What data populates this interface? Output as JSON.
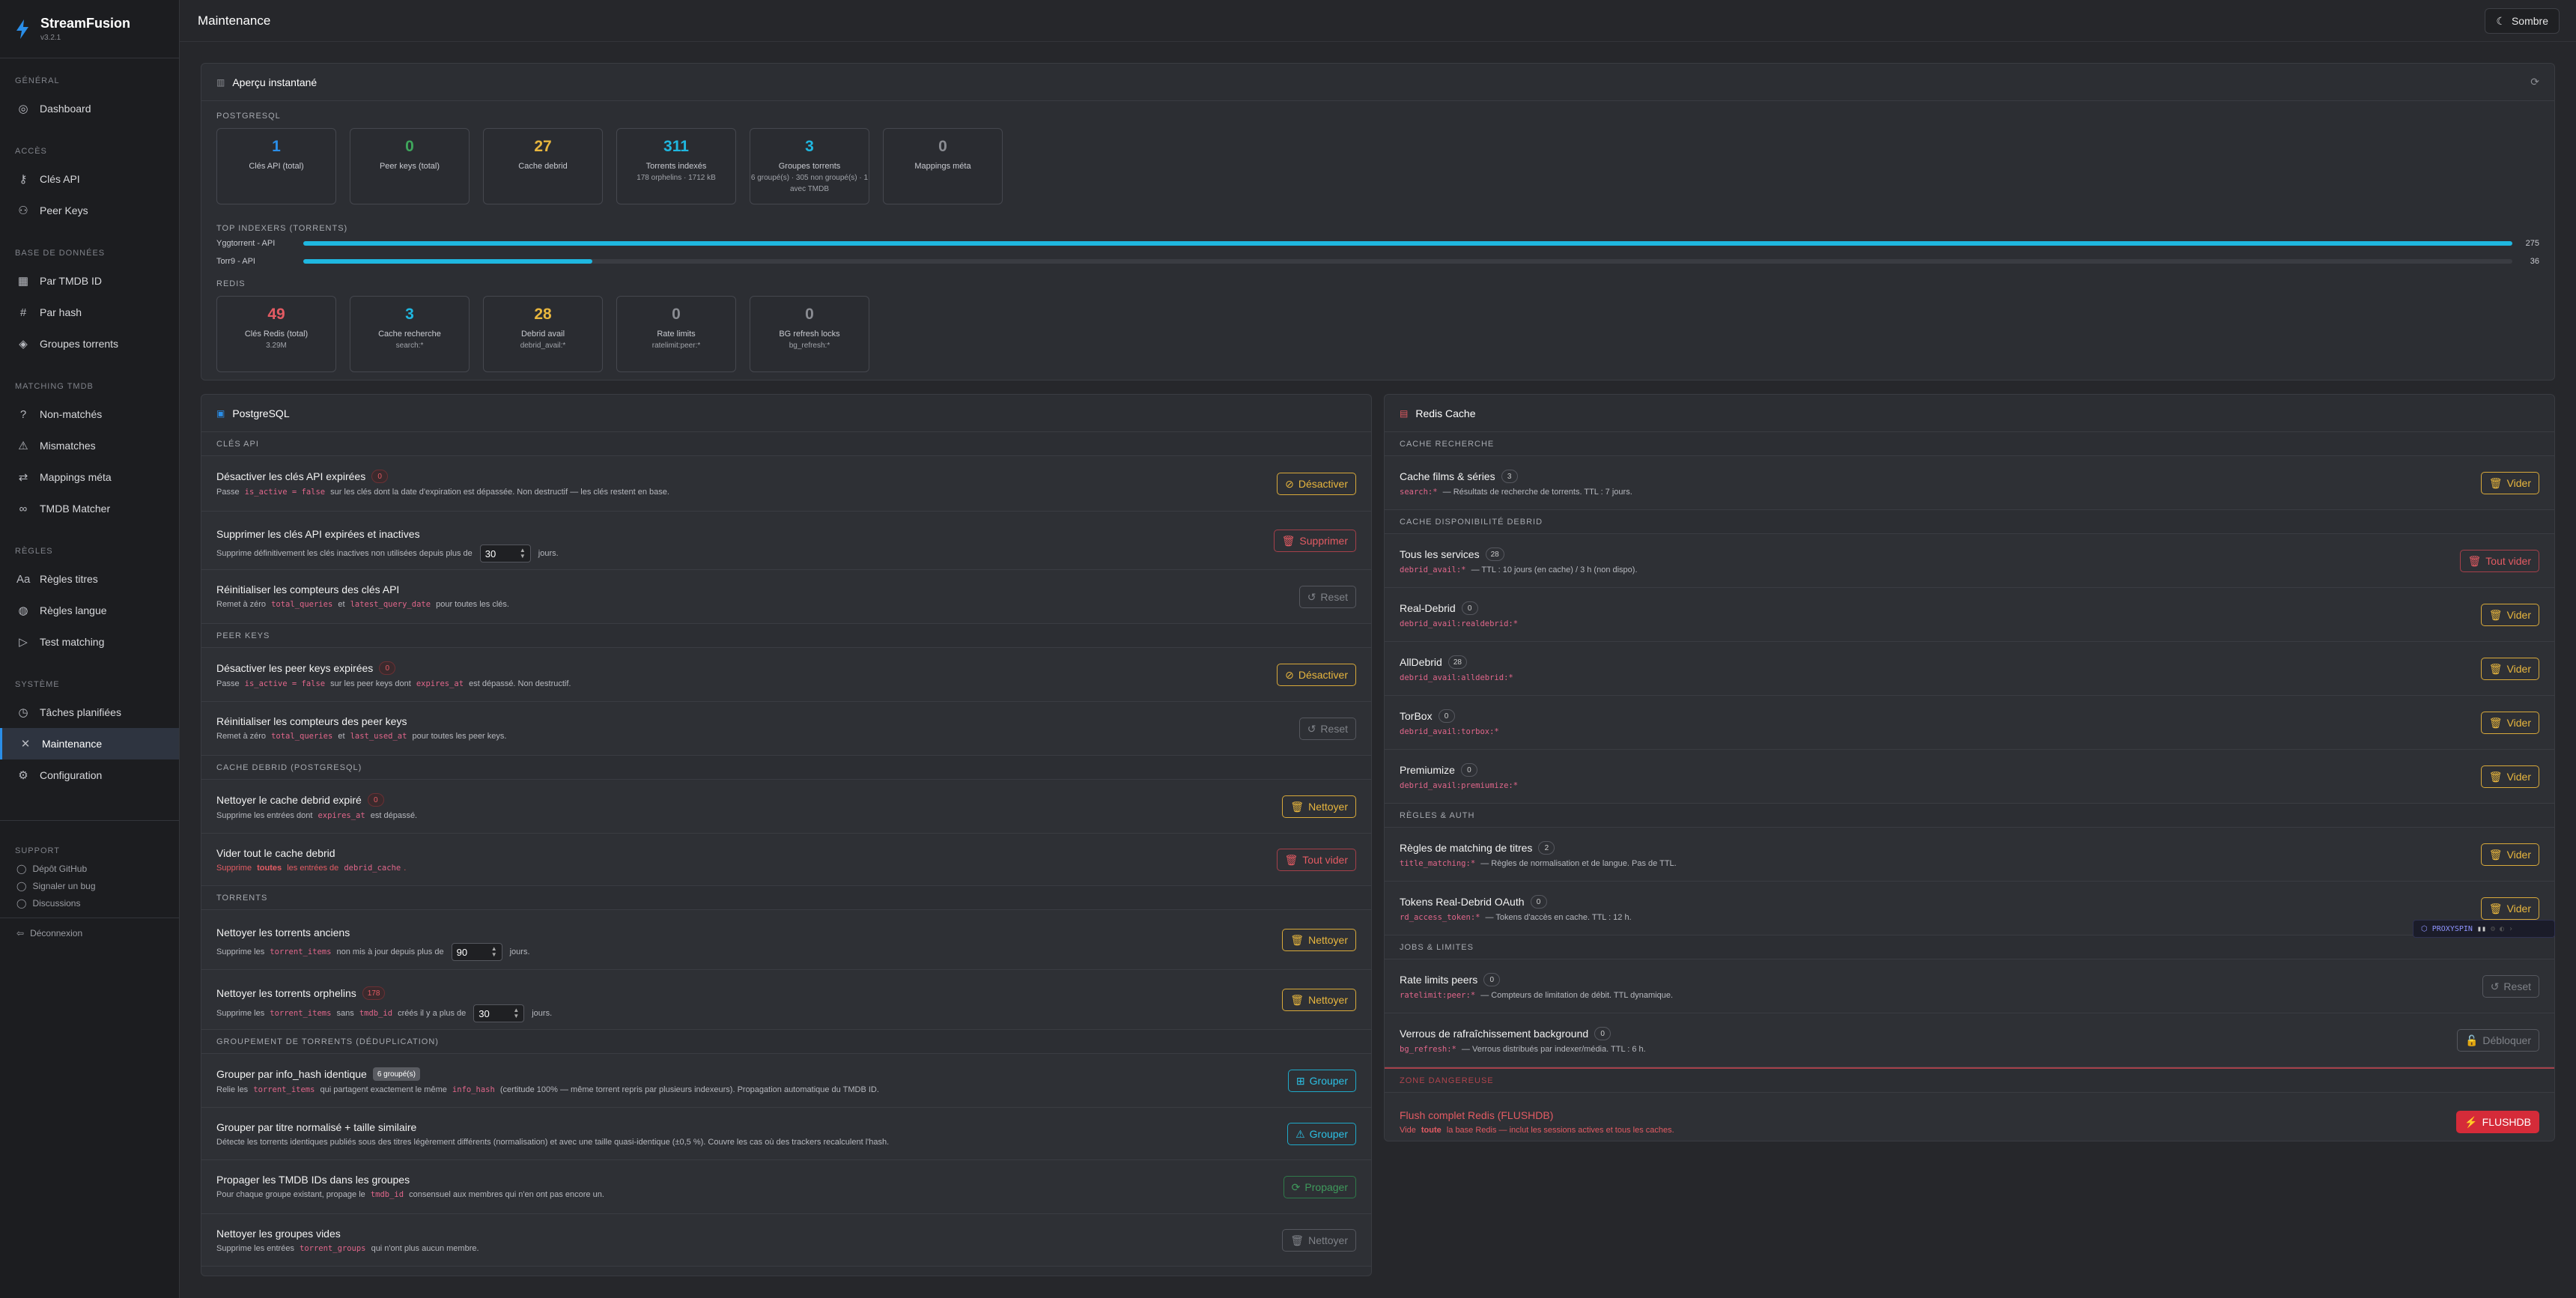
{
  "app": {
    "name": "StreamFusion",
    "version": "v3.2.1"
  },
  "sidebar": {
    "sections": [
      {
        "title": "Général",
        "items": [
          {
            "label": "Dashboard",
            "icon": "dashboard-icon"
          }
        ]
      },
      {
        "title": "Accès",
        "items": [
          {
            "label": "Clés API",
            "icon": "key-icon"
          },
          {
            "label": "Peer Keys",
            "icon": "users-icon"
          }
        ]
      },
      {
        "title": "Base de données",
        "items": [
          {
            "label": "Par TMDB ID",
            "icon": "film-icon"
          },
          {
            "label": "Par hash",
            "icon": "hash-icon"
          },
          {
            "label": "Groupes torrents",
            "icon": "layers-icon"
          }
        ]
      },
      {
        "title": "Matching TMDB",
        "items": [
          {
            "label": "Non-matchés",
            "icon": "help-circle-icon"
          },
          {
            "label": "Mismatches",
            "icon": "alert-icon"
          },
          {
            "label": "Mappings méta",
            "icon": "shuffle-icon"
          },
          {
            "label": "TMDB Matcher",
            "icon": "link-icon"
          }
        ]
      },
      {
        "title": "Règles",
        "items": [
          {
            "label": "Règles titres",
            "icon": "text-icon"
          },
          {
            "label": "Règles langue",
            "icon": "globe-icon"
          },
          {
            "label": "Test matching",
            "icon": "play-icon"
          }
        ]
      },
      {
        "title": "Système",
        "items": [
          {
            "label": "Tâches planifiées",
            "icon": "clock-icon"
          },
          {
            "label": "Maintenance",
            "icon": "tools-icon",
            "active": true
          },
          {
            "label": "Configuration",
            "icon": "gear-icon"
          }
        ]
      }
    ],
    "support": {
      "title": "Support",
      "links": [
        "Dépôt GitHub",
        "Signaler un bug",
        "Discussions"
      ]
    },
    "logout": "Déconnexion"
  },
  "header": {
    "title": "Maintenance",
    "theme_label": "Sombre"
  },
  "overview": {
    "title": "Aperçu instantané",
    "postgres_label": "PostgreSQL",
    "postgres_stats": [
      {
        "value": "1",
        "label": "Clés API (total)",
        "sub": "",
        "color": "#2a8ee8"
      },
      {
        "value": "0",
        "label": "Peer keys (total)",
        "sub": "",
        "color": "#3fa65c"
      },
      {
        "value": "27",
        "label": "Cache debrid",
        "sub": "",
        "color": "#e8b63e"
      },
      {
        "value": "311",
        "label": "Torrents indexés",
        "sub": "178 orphelins · 1712 kB",
        "color": "#1fb7e0"
      },
      {
        "value": "3",
        "label": "Groupes torrents",
        "sub": "6 groupé(s) · 305 non groupé(s) · 1 avec TMDB",
        "color": "#1fb7e0"
      },
      {
        "value": "0",
        "label": "Mappings méta",
        "sub": "",
        "color": "#8a8c92"
      }
    ],
    "indexers_label": "Top indexers (torrents)",
    "indexers": [
      {
        "name": "Yggtorrent - API",
        "value": 275,
        "max": 275
      },
      {
        "name": "Torr9 - API",
        "value": 36,
        "max": 275
      }
    ],
    "redis_label": "Redis",
    "redis_stats": [
      {
        "value": "49",
        "label": "Clés Redis (total)",
        "sub": "3.29M",
        "color": "#e35b63"
      },
      {
        "value": "3",
        "label": "Cache recherche",
        "sub": "search:*",
        "color": "#1fb7e0"
      },
      {
        "value": "28",
        "label": "Debrid avail",
        "sub": "debrid_avail:*",
        "color": "#e8b63e"
      },
      {
        "value": "0",
        "label": "Rate limits",
        "sub": "ratelimit:peer:*",
        "color": "#8a8c92"
      },
      {
        "value": "0",
        "label": "BG refresh locks",
        "sub": "bg_refresh:*",
        "color": "#8a8c92"
      }
    ]
  },
  "pg": {
    "title": "PostgreSQL",
    "groups": [
      {
        "label": "Clés API",
        "ops": [
          {
            "title": "Désactiver les clés API expirées",
            "badge": "0",
            "badge_style": "red",
            "desc": [
              [
                "t",
                "Passe "
              ],
              [
                "c",
                "is_active = false"
              ],
              [
                "t",
                " sur les clés dont la date d'expiration est dépassée. Non destructif — les clés restent en base."
              ]
            ],
            "btn": "Désactiver",
            "btn_style": "y",
            "btn_icon": "⊘",
            "h": 74
          },
          {
            "title": "Supprimer les clés API expirées et inactives",
            "desc": [
              [
                "t",
                "Supprime définitivement les clés inactives non utilisées depuis plus de"
              ],
              [
                "n",
                "30"
              ],
              [
                "t",
                "jours."
              ]
            ],
            "btn": "Supprimer",
            "btn_style": "r",
            "btn_icon": "🗑",
            "h": 78
          },
          {
            "title": "Réinitialiser les compteurs des clés API",
            "desc": [
              [
                "t",
                "Remet à zéro "
              ],
              [
                "c",
                "total_queries"
              ],
              [
                "t",
                " et "
              ],
              [
                "c",
                "latest_query_date"
              ],
              [
                "t",
                " pour toutes les clés."
              ]
            ],
            "btn": "Reset",
            "btn_style": "dis",
            "btn_icon": "↺",
            "h": 72
          }
        ]
      },
      {
        "label": "Peer keys",
        "ops": [
          {
            "title": "Désactiver les peer keys expirées",
            "badge": "0",
            "badge_style": "red",
            "desc": [
              [
                "t",
                "Passe "
              ],
              [
                "c",
                "is_active = false"
              ],
              [
                "t",
                " sur les peer keys dont "
              ],
              [
                "c",
                "expires_at"
              ],
              [
                "t",
                " est dépassé. Non destructif."
              ]
            ],
            "btn": "Désactiver",
            "btn_style": "y",
            "btn_icon": "⊘",
            "h": 72
          },
          {
            "title": "Réinitialiser les compteurs des peer keys",
            "desc": [
              [
                "t",
                "Remet à zéro "
              ],
              [
                "c",
                "total_queries"
              ],
              [
                "t",
                " et "
              ],
              [
                "c",
                "last_used_at"
              ],
              [
                "t",
                " pour toutes les peer keys."
              ]
            ],
            "btn": "Reset",
            "btn_style": "dis",
            "btn_icon": "↺",
            "h": 72
          }
        ]
      },
      {
        "label": "Cache debrid (PostgreSQL)",
        "ops": [
          {
            "title": "Nettoyer le cache debrid expiré",
            "badge": "0",
            "badge_style": "red",
            "desc": [
              [
                "t",
                "Supprime les entrées dont "
              ],
              [
                "c",
                "expires_at"
              ],
              [
                "t",
                " est dépassé."
              ]
            ],
            "btn": "Nettoyer",
            "btn_style": "y",
            "btn_icon": "🗑",
            "h": 72
          },
          {
            "title": "Vider tout le cache debrid",
            "desc": [
              [
                "r",
                "Supprime "
              ],
              [
                "rb",
                "toutes"
              ],
              [
                "r",
                " les entrées de "
              ],
              [
                "c",
                "debrid_cache"
              ],
              [
                "r",
                "."
              ]
            ],
            "btn": "Tout vider",
            "btn_style": "r",
            "btn_icon": "🗑",
            "h": 70
          }
        ]
      },
      {
        "label": "Torrents",
        "ops": [
          {
            "title": "Nettoyer les torrents anciens",
            "desc": [
              [
                "t",
                "Supprime les "
              ],
              [
                "c",
                "torrent_items"
              ],
              [
                "t",
                " non mis à jour depuis plus de"
              ],
              [
                "n",
                "90"
              ],
              [
                "t",
                "jours."
              ]
            ],
            "btn": "Nettoyer",
            "btn_style": "y",
            "btn_icon": "🗑",
            "h": 80
          },
          {
            "title": "Nettoyer les torrents orphelins",
            "badge": "178",
            "badge_style": "red",
            "desc": [
              [
                "t",
                "Supprime les "
              ],
              [
                "c",
                "torrent_items"
              ],
              [
                "t",
                " sans "
              ],
              [
                "c",
                "tmdb_id"
              ],
              [
                "t",
                " créés il y a plus de"
              ],
              [
                "n",
                "30"
              ],
              [
                "t",
                "jours."
              ]
            ],
            "btn": "Nettoyer",
            "btn_style": "y",
            "btn_icon": "🗑",
            "h": 80
          }
        ]
      },
      {
        "label": "Groupement de torrents (déduplication)",
        "ops": [
          {
            "title": "Grouper par info_hash identique",
            "badge": "6 groupé(s)",
            "badge_style": "gray",
            "desc": [
              [
                "t",
                "Relie les "
              ],
              [
                "c",
                "torrent_items"
              ],
              [
                "t",
                " qui partagent exactement le même "
              ],
              [
                "c",
                "info_hash"
              ],
              [
                "t",
                " (certitude 100% — même torrent repris par plusieurs indexeurs). Propagation automatique du TMDB ID."
              ]
            ],
            "btn": "Grouper",
            "btn_style": "c",
            "btn_icon": "⊞",
            "h": 72
          },
          {
            "title": "Grouper par titre normalisé + taille similaire",
            "desc": [
              [
                "t",
                "Détecte les torrents identiques publiés sous des titres légèrement différents (normalisation) et avec une taille quasi-identique (±0,5 %). Couvre les cas où des trackers recalculent l'hash."
              ]
            ],
            "btn": "Grouper",
            "btn_style": "c",
            "btn_icon": "⚠",
            "h": 70
          },
          {
            "title": "Propager les TMDB IDs dans les groupes",
            "desc": [
              [
                "t",
                "Pour chaque groupe existant, propage le "
              ],
              [
                "c",
                "tmdb_id"
              ],
              [
                "t",
                " consensuel aux membres qui n'en ont pas encore un."
              ]
            ],
            "btn": "Propager",
            "btn_style": "g",
            "btn_icon": "⟳",
            "h": 72
          },
          {
            "title": "Nettoyer les groupes vides",
            "desc": [
              [
                "t",
                "Supprime les entrées "
              ],
              [
                "c",
                "torrent_groups"
              ],
              [
                "t",
                " qui n'ont plus aucun membre."
              ]
            ],
            "btn": "Nettoyer",
            "btn_style": "dis",
            "btn_icon": "🗑",
            "h": 70
          }
        ]
      }
    ]
  },
  "redis": {
    "title": "Redis Cache",
    "groups": [
      {
        "label": "Cache recherche",
        "ops": [
          {
            "title": "Cache films & séries",
            "badge": "3",
            "desc": [
              [
                "c",
                "search:*"
              ],
              [
                "t",
                " — Résultats de recherche de torrents. TTL : 7 jours."
              ]
            ],
            "btn": "Vider",
            "btn_style": "y",
            "btn_icon": "🗑",
            "h": 72
          }
        ]
      },
      {
        "label": "Cache disponibilité debrid",
        "ops": [
          {
            "title": "Tous les services",
            "badge": "28",
            "desc": [
              [
                "c",
                "debrid_avail:*"
              ],
              [
                "t",
                " — TTL : 10 jours (en cache) / 3 h (non dispo)."
              ]
            ],
            "btn": "Tout vider",
            "btn_style": "r",
            "btn_icon": "🗑",
            "h": 72
          },
          {
            "title": "Real-Debrid",
            "badge": "0",
            "desc": [
              [
                "c",
                "debrid_avail:realdebrid:*"
              ]
            ],
            "btn": "Vider",
            "btn_style": "y",
            "btn_icon": "🗑",
            "h": 72
          },
          {
            "title": "AllDebrid",
            "badge": "28",
            "desc": [
              [
                "c",
                "debrid_avail:alldebrid:*"
              ]
            ],
            "btn": "Vider",
            "btn_style": "y",
            "btn_icon": "🗑",
            "h": 72
          },
          {
            "title": "TorBox",
            "badge": "0",
            "desc": [
              [
                "c",
                "debrid_avail:torbox:*"
              ]
            ],
            "btn": "Vider",
            "btn_style": "y",
            "btn_icon": "🗑",
            "h": 72
          },
          {
            "title": "Premiumize",
            "badge": "0",
            "desc": [
              [
                "c",
                "debrid_avail:premiumize:*"
              ]
            ],
            "btn": "Vider",
            "btn_style": "y",
            "btn_icon": "🗑",
            "h": 72
          }
        ]
      },
      {
        "label": "Règles & auth",
        "ops": [
          {
            "title": "Règles de matching de titres",
            "badge": "2",
            "desc": [
              [
                "c",
                "title_matching:*"
              ],
              [
                "t",
                " — Règles de normalisation et de langue. Pas de TTL."
              ]
            ],
            "btn": "Vider",
            "btn_style": "y",
            "btn_icon": "🗑",
            "h": 72
          },
          {
            "title": "Tokens Real-Debrid OAuth",
            "badge": "0",
            "desc": [
              [
                "c",
                "rd_access_token:*"
              ],
              [
                "t",
                " — Tokens d'accès en cache. TTL : 12 h."
              ]
            ],
            "btn": "Vider",
            "btn_style": "y",
            "btn_icon": "🗑",
            "h": 72
          }
        ]
      },
      {
        "label": "Jobs & limites",
        "ops": [
          {
            "title": "Rate limits peers",
            "badge": "0",
            "desc": [
              [
                "c",
                "ratelimit:peer:*"
              ],
              [
                "t",
                " — Compteurs de limitation de débit. TTL dynamique."
              ]
            ],
            "btn": "Reset",
            "btn_style": "dis",
            "btn_icon": "↺",
            "h": 72
          },
          {
            "title": "Verrous de rafraîchissement background",
            "badge": "0",
            "desc": [
              [
                "c",
                "bg_refresh:*"
              ],
              [
                "t",
                " — Verrous distribués par indexer/média. TTL : 6 h."
              ]
            ],
            "btn": "Débloquer",
            "btn_style": "dis",
            "btn_icon": "🔓",
            "h": 72
          }
        ]
      }
    ],
    "danger": {
      "label": "Zone dangereuse",
      "title": "Flush complet Redis (FLUSHDB)",
      "desc": [
        [
          "r",
          "Vide "
        ],
        [
          "rb",
          "toute"
        ],
        [
          "r",
          " la base Redis — inclut les sessions actives et tous les caches."
        ]
      ],
      "btn": "FLUSHDB",
      "btn_icon": "⚡"
    }
  },
  "proxy_badge": "PROXYSPIN"
}
